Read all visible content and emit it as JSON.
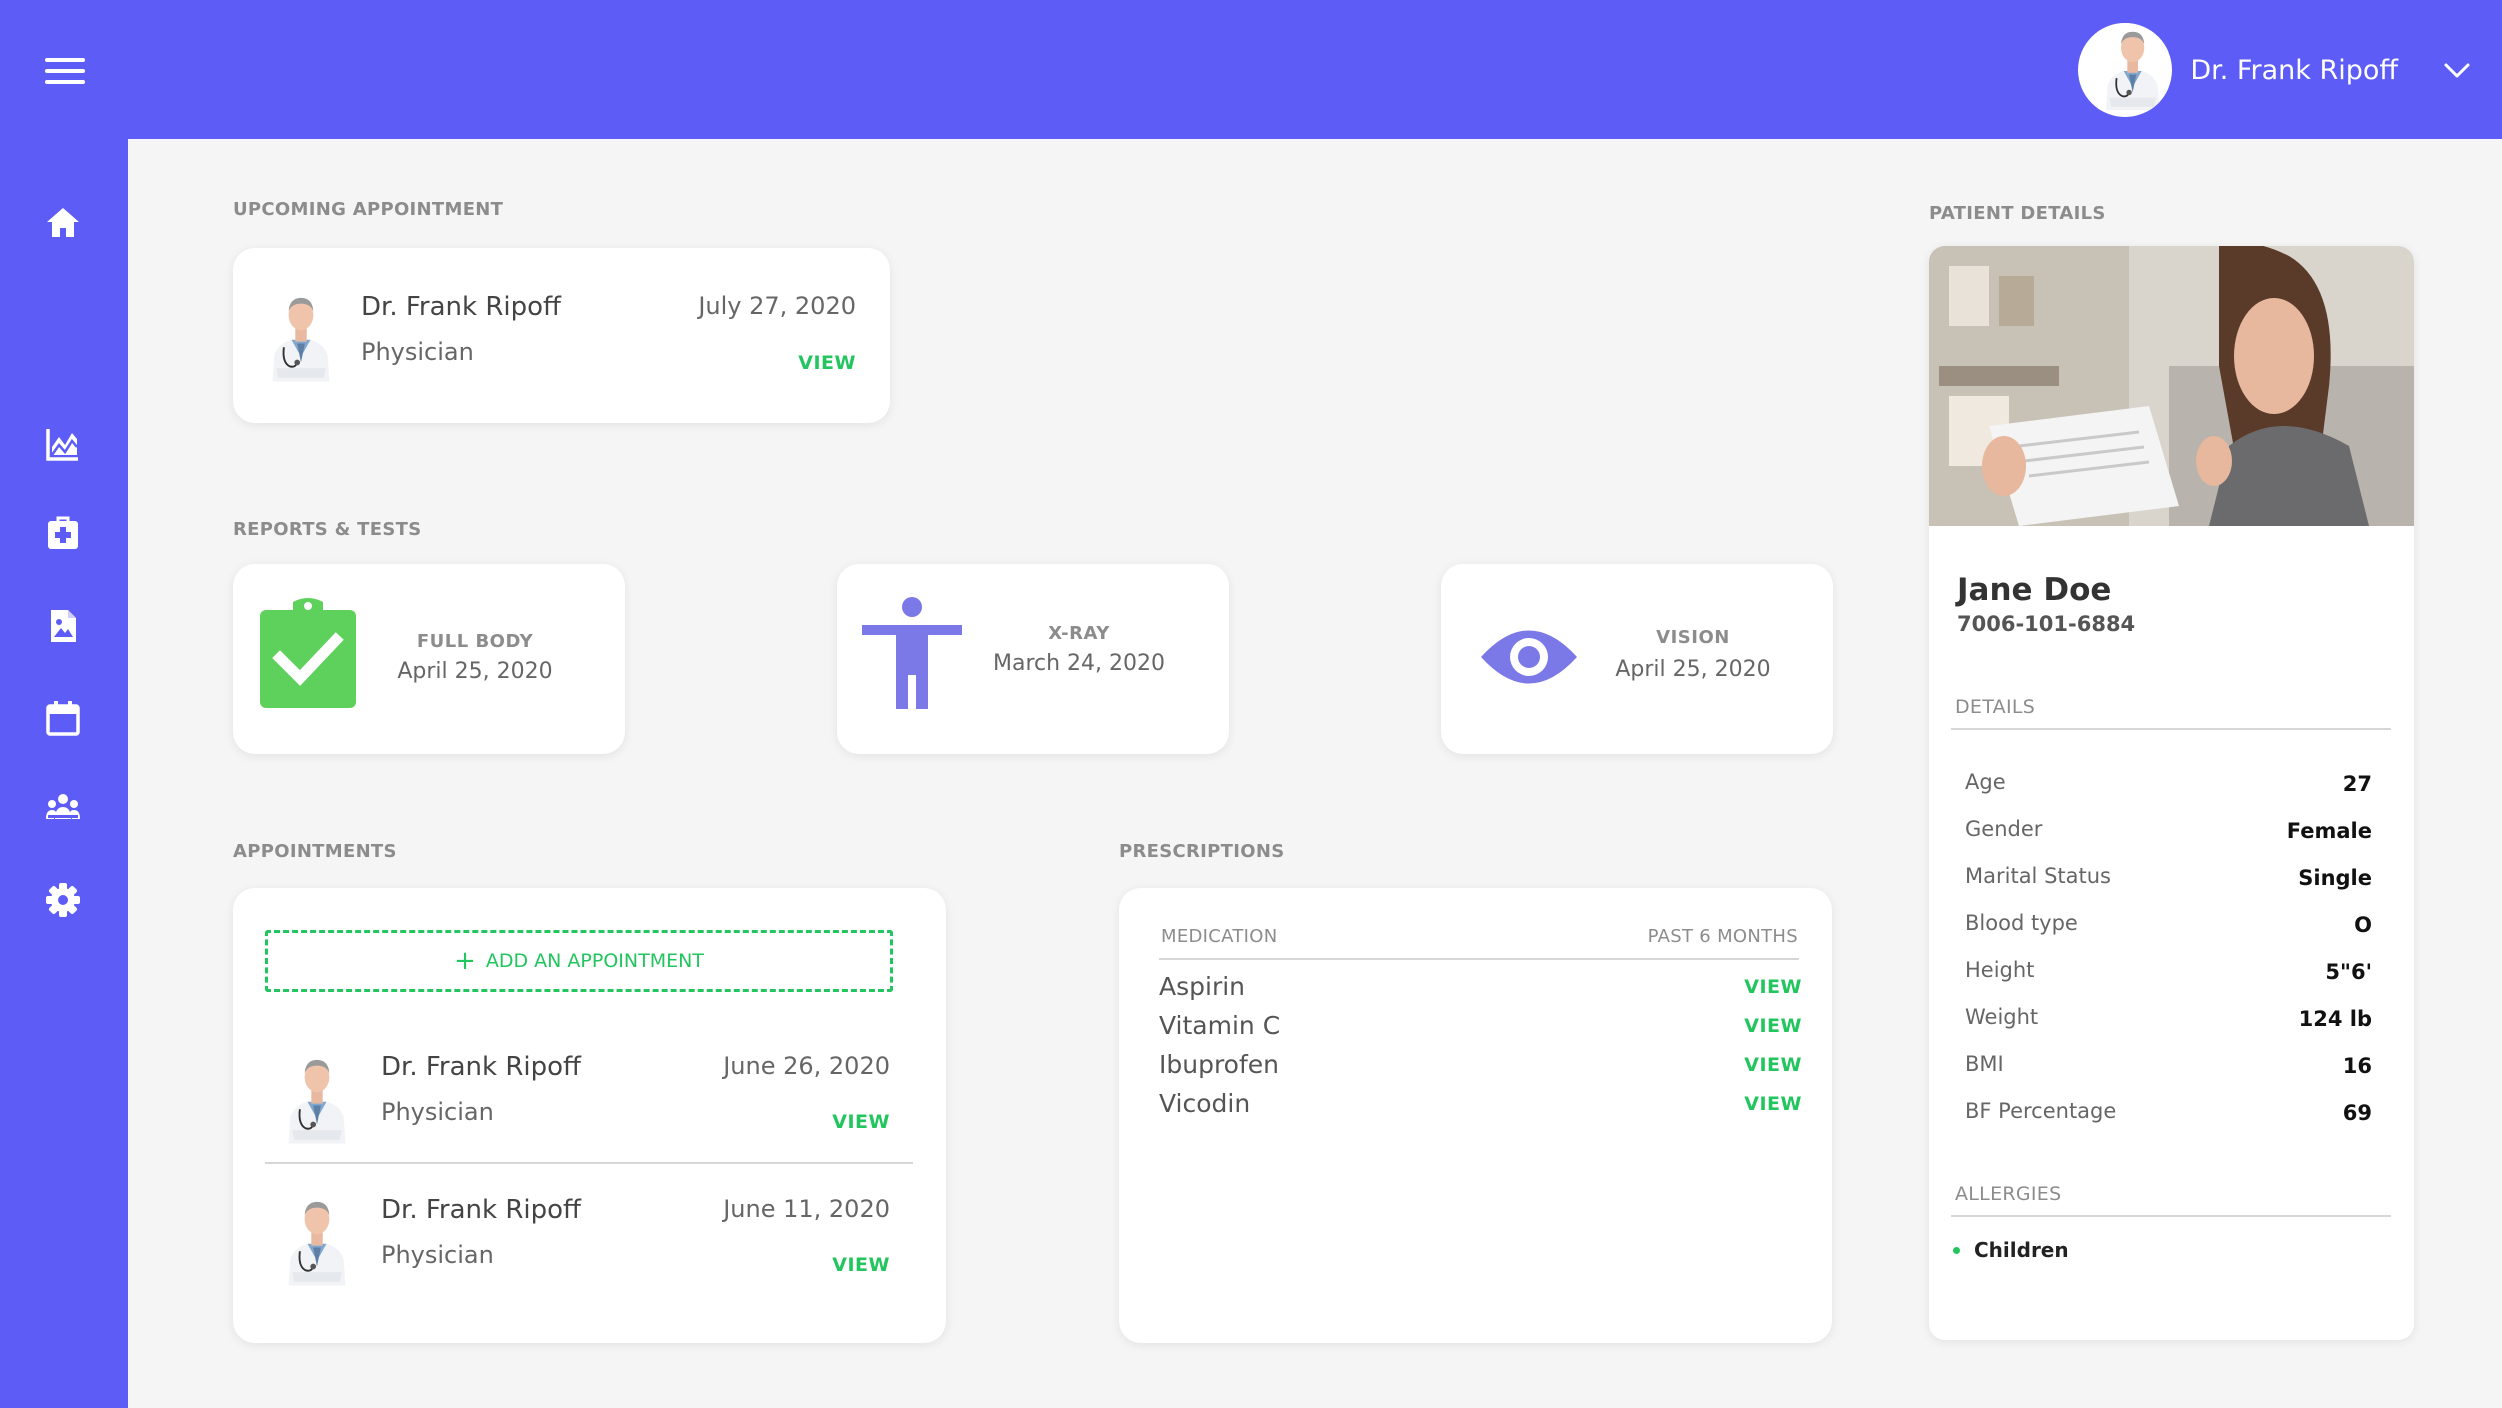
{
  "header": {
    "user_name": "Dr. Frank Ripoff"
  },
  "sidebar": {
    "items": [
      {
        "icon": "home-icon"
      },
      {
        "icon": "chart-icon"
      },
      {
        "icon": "medical-box-icon"
      },
      {
        "icon": "image-file-icon"
      },
      {
        "icon": "calendar-icon"
      },
      {
        "icon": "people-icon"
      },
      {
        "icon": "gear-icon"
      }
    ]
  },
  "upcoming": {
    "label": "UPCOMING APPOINTMENT",
    "doctor": "Dr. Frank Ripoff",
    "role": "Physician",
    "date": "July 27, 2020",
    "view": "VIEW"
  },
  "reports": {
    "label": "REPORTS & TESTS",
    "items": [
      {
        "title": "FULL BODY",
        "date": "April 25, 2020",
        "icon": "clipboard-check-icon"
      },
      {
        "title": "X-RAY",
        "date": "March 24, 2020",
        "icon": "body-icon"
      },
      {
        "title": "VISION",
        "date": "April 25, 2020",
        "icon": "eye-icon"
      }
    ]
  },
  "appointments": {
    "label": "APPOINTMENTS",
    "add_label": "ADD AN APPOINTMENT",
    "items": [
      {
        "doctor": "Dr. Frank Ripoff",
        "role": "Physician",
        "date": "June 26, 2020",
        "view": "VIEW"
      },
      {
        "doctor": "Dr. Frank Ripoff",
        "role": "Physician",
        "date": "June 11, 2020",
        "view": "VIEW"
      }
    ]
  },
  "prescriptions": {
    "label": "PRESCRIPTIONS",
    "col_medication": "MEDICATION",
    "col_period": "PAST 6 MONTHS",
    "items": [
      {
        "name": "Aspirin",
        "view": "VIEW"
      },
      {
        "name": "Vitamin C",
        "view": "VIEW"
      },
      {
        "name": "Ibuprofen",
        "view": "VIEW"
      },
      {
        "name": "Vicodin",
        "view": "VIEW"
      }
    ]
  },
  "patient": {
    "label": "PATIENT DETAILS",
    "name": "Jane Doe",
    "id": "7006-101-6884",
    "details_label": "DETAILS",
    "details": [
      {
        "label": "Age",
        "value": "27"
      },
      {
        "label": "Gender",
        "value": "Female"
      },
      {
        "label": "Marital Status",
        "value": "Single"
      },
      {
        "label": "Blood type",
        "value": "O"
      },
      {
        "label": "Height",
        "value": "5\"6'"
      },
      {
        "label": "Weight",
        "value": "124 lb"
      },
      {
        "label": "BMI",
        "value": "16"
      },
      {
        "label": "BF Percentage",
        "value": "69"
      }
    ],
    "allergies_label": "ALLERGIES",
    "allergies": [
      "Children"
    ]
  },
  "colors": {
    "brand": "#5d5cf6",
    "accent_green": "#22c55e",
    "test_green": "#5ed15c",
    "icon_purple": "#7b78e8"
  }
}
